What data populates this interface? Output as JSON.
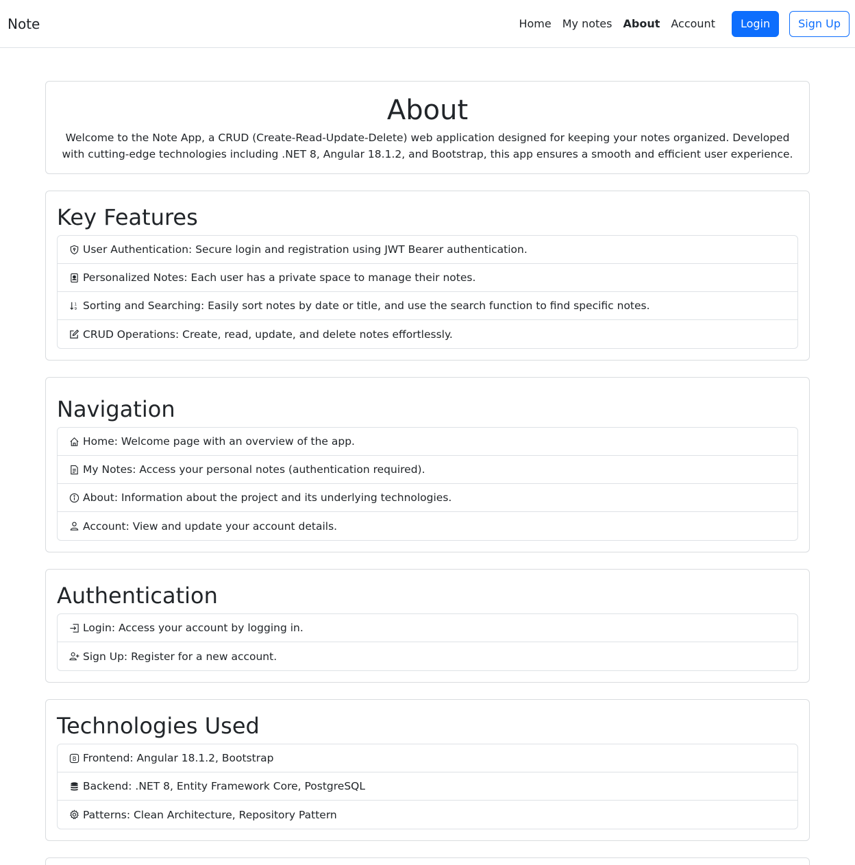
{
  "nav": {
    "brand": "Note",
    "links": [
      "Home",
      "My notes",
      "About",
      "Account"
    ],
    "login": "Login",
    "signup": "Sign Up"
  },
  "about": {
    "title": "About",
    "description": "Welcome to the Note App, a CRUD (Create-Read-Update-Delete) web application designed for keeping your notes organized. Developed with cutting-edge technologies including .NET 8, Angular 18.1.2, and Bootstrap, this app ensures a smooth and efficient user experience."
  },
  "sections": [
    {
      "title": "Key Features",
      "items": [
        {
          "icon": "shield-icon",
          "text": "User Authentication: Secure login and registration using JWT Bearer authentication."
        },
        {
          "icon": "person-badge-icon",
          "text": "Personalized Notes: Each user has a private space to manage their notes."
        },
        {
          "icon": "sort-icon",
          "text": "Sorting and Searching: Easily sort notes by date or title, and use the search function to find specific notes."
        },
        {
          "icon": "pencil-square-icon",
          "text": "CRUD Operations: Create, read, update, and delete notes effortlessly."
        }
      ]
    },
    {
      "title": "Navigation",
      "items": [
        {
          "icon": "house-icon",
          "text": "Home: Welcome page with an overview of the app."
        },
        {
          "icon": "file-text-icon",
          "text": "My Notes: Access your personal notes (authentication required)."
        },
        {
          "icon": "info-circle-icon",
          "text": "About: Information about the project and its underlying technologies."
        },
        {
          "icon": "person-icon",
          "text": "Account: View and update your account details."
        }
      ]
    },
    {
      "title": "Authentication",
      "items": [
        {
          "icon": "box-arrow-in-icon",
          "text": "Login: Access your account by logging in."
        },
        {
          "icon": "person-plus-icon",
          "text": "Sign Up: Register for a new account."
        }
      ]
    },
    {
      "title": "Technologies Used",
      "items": [
        {
          "icon": "bootstrap-icon",
          "text": "Frontend: Angular 18.1.2, Bootstrap"
        },
        {
          "icon": "database-icon",
          "text": "Backend: .NET 8, Entity Framework Core, PostgreSQL"
        },
        {
          "icon": "gear-icon",
          "text": "Patterns: Clean Architecture, Repository Pattern"
        }
      ]
    }
  ]
}
